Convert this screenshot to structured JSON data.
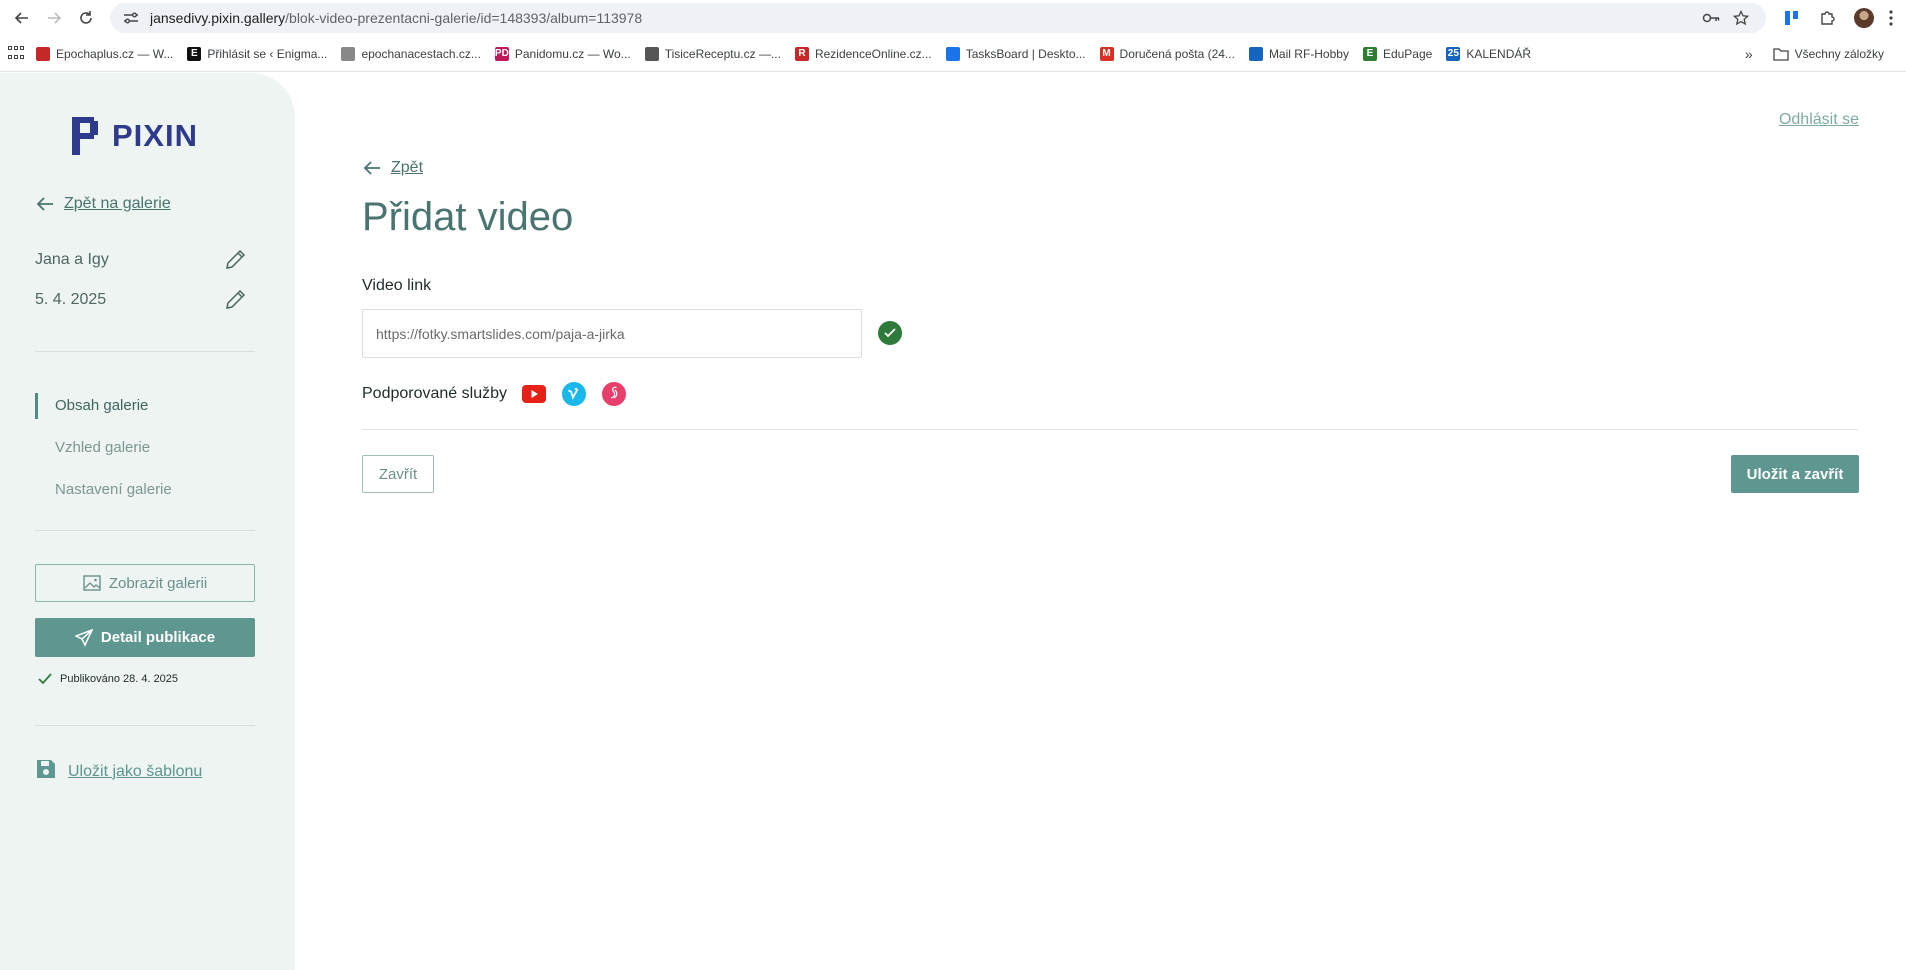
{
  "browser": {
    "url_host": "jansedivy.pixin.gallery",
    "url_path": "/blok-video-prezentacni-galerie/id=148393/album=113978",
    "bookmarks": [
      {
        "label": "Epochaplus.cz — W...",
        "color": "#c62828",
        "glyph": ""
      },
      {
        "label": "Přihlásit se ‹ Enigma...",
        "color": "#111111",
        "glyph": "E"
      },
      {
        "label": "epochanacestach.cz...",
        "color": "#888888",
        "glyph": ""
      },
      {
        "label": "Panidomu.cz — Wo...",
        "color": "#c2185b",
        "glyph": "PD"
      },
      {
        "label": "TisiceReceptu.cz —...",
        "color": "#555555",
        "glyph": ""
      },
      {
        "label": "RezidenceOnline.cz...",
        "color": "#c62828",
        "glyph": "R"
      },
      {
        "label": "TasksBoard | Deskto...",
        "color": "#1a73e8",
        "glyph": ""
      },
      {
        "label": "Doručená pošta (24...",
        "color": "#d93025",
        "glyph": "M"
      },
      {
        "label": "Mail RF-Hobby",
        "color": "#1565c0",
        "glyph": ""
      },
      {
        "label": "EduPage",
        "color": "#2e7d32",
        "glyph": "E"
      },
      {
        "label": "KALENDÁŘ",
        "color": "#1565c0",
        "glyph": "25"
      }
    ],
    "all_bookmarks": "Všechny záložky"
  },
  "sidebar": {
    "logo_text": "PIXIN",
    "back_label": "Zpět na galerie",
    "gallery_name": "Jana a Igy",
    "gallery_date": "5. 4. 2025",
    "menu": [
      {
        "label": "Obsah galerie",
        "active": true
      },
      {
        "label": "Vzhled galerie",
        "active": false
      },
      {
        "label": "Nastavení galerie",
        "active": false
      }
    ],
    "show_gallery_label": "Zobrazit galerii",
    "publish_detail_label": "Detail publikace",
    "published_text": "Publikováno 28. 4. 2025",
    "save_template_label": "Uložit jako šablonu"
  },
  "main": {
    "logout_label": "Odhlásit se",
    "back_label": "Zpět",
    "title": "Přidat video",
    "video_link_label": "Video link",
    "video_link_value": "https://fotky.smartslides.com/paja-a-jirka",
    "supported_services_label": "Podporované služby",
    "services": [
      "youtube-icon",
      "vimeo-icon",
      "smartslides-icon"
    ],
    "close_label": "Zavřít",
    "save_close_label": "Uložit a zavřít"
  },
  "colors": {
    "accent": "#5e9690",
    "sidebar_bg": "#edf4f1",
    "logo": "#2e3a8c",
    "valid": "#2f7a3b"
  }
}
